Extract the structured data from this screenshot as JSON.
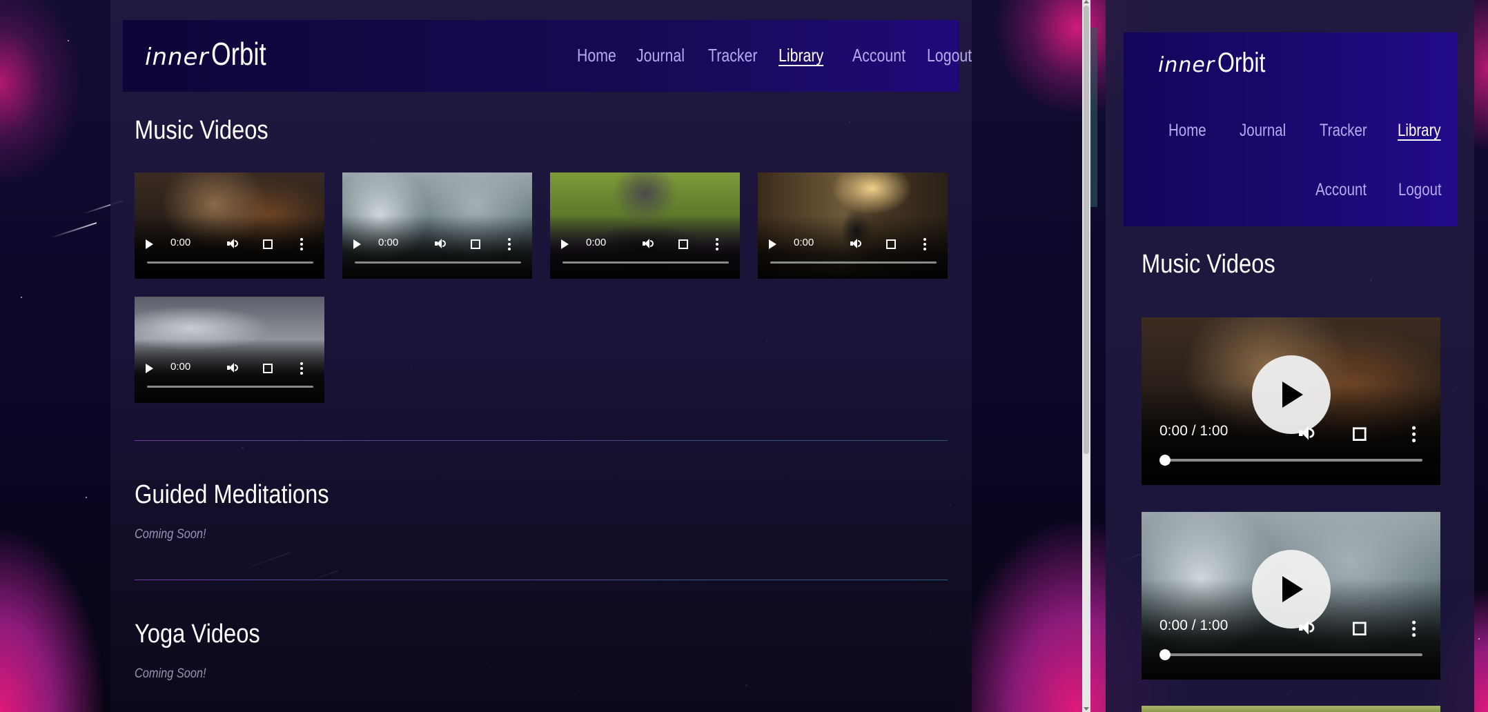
{
  "brand": {
    "logo_script": "inner",
    "logo_word": "Orbit"
  },
  "nav": {
    "items": [
      {
        "label": "Home",
        "active": false
      },
      {
        "label": "Journal",
        "active": false
      },
      {
        "label": "Tracker",
        "active": false
      },
      {
        "label": "Library",
        "active": true
      },
      {
        "label": "Account",
        "active": false
      },
      {
        "label": "Logout",
        "active": false
      }
    ]
  },
  "sections": {
    "music": {
      "title": "Music Videos"
    },
    "meditations": {
      "title": "Guided Meditations",
      "status": "Coming Soon!"
    },
    "yoga": {
      "title": "Yoga Videos",
      "status": "Coming Soon!"
    }
  },
  "music_videos": [
    {
      "thumb": "warm-bowl-closeup",
      "time": "0:00",
      "progress": 0
    },
    {
      "thumb": "rain-on-window",
      "time": "0:00",
      "progress": 0
    },
    {
      "thumb": "yoga-seated-grass",
      "time": "0:00",
      "progress": 0
    },
    {
      "thumb": "sunlit-street-walker",
      "time": "0:00",
      "progress": 0
    },
    {
      "thumb": "cloudy-sea-birds",
      "time": "0:00",
      "progress": 0
    }
  ],
  "mobile_view": {
    "videos": [
      {
        "thumb": "warm-bowl-closeup",
        "time_display": "0:00 / 1:00",
        "progress": 0
      },
      {
        "thumb": "rain-on-window",
        "time_display": "0:00 / 1:00",
        "progress": 0
      }
    ]
  },
  "colors": {
    "nav_link": "#b7a9f0",
    "nav_link_active": "#ffffff",
    "nav_bg_start": "#0d0638",
    "nav_bg_end": "#21097a",
    "page_bg": "#1a1438",
    "accent_nebula": "#e0197a",
    "muted_text": "#9a93b5"
  },
  "icons": [
    "play-icon",
    "volume-icon",
    "fullscreen-icon",
    "more-options-icon"
  ]
}
